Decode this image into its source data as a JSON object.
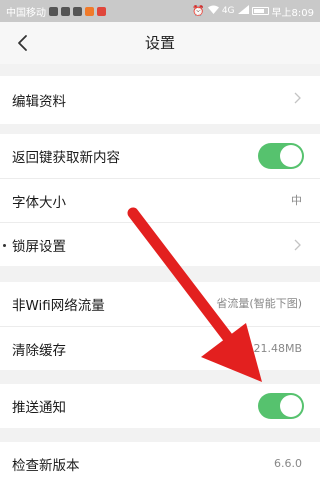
{
  "status_bar": {
    "carrier": "中国移动",
    "signal": "4G",
    "time": "早上8:09"
  },
  "header": {
    "title": "设置"
  },
  "settings": {
    "group1": [
      {
        "label": "编辑资料",
        "kind": "link"
      }
    ],
    "group2": [
      {
        "label": "返回键获取新内容",
        "kind": "toggle",
        "on": true
      },
      {
        "label": "字体大小",
        "kind": "value",
        "value": "中"
      },
      {
        "label": "锁屏设置",
        "kind": "link"
      }
    ],
    "group3": [
      {
        "label": "非Wifi网络流量",
        "kind": "value",
        "value": "省流量(智能下图)"
      },
      {
        "label": "清除缓存",
        "kind": "value",
        "value": "21.48MB"
      }
    ],
    "group4": [
      {
        "label": "推送通知",
        "kind": "toggle",
        "on": true
      }
    ],
    "group5": [
      {
        "label": "检查新版本",
        "kind": "value",
        "value": "6.6.0"
      }
    ]
  },
  "colors": {
    "toggle_on": "#56c26e",
    "annotation_arrow": "#e3201f"
  }
}
